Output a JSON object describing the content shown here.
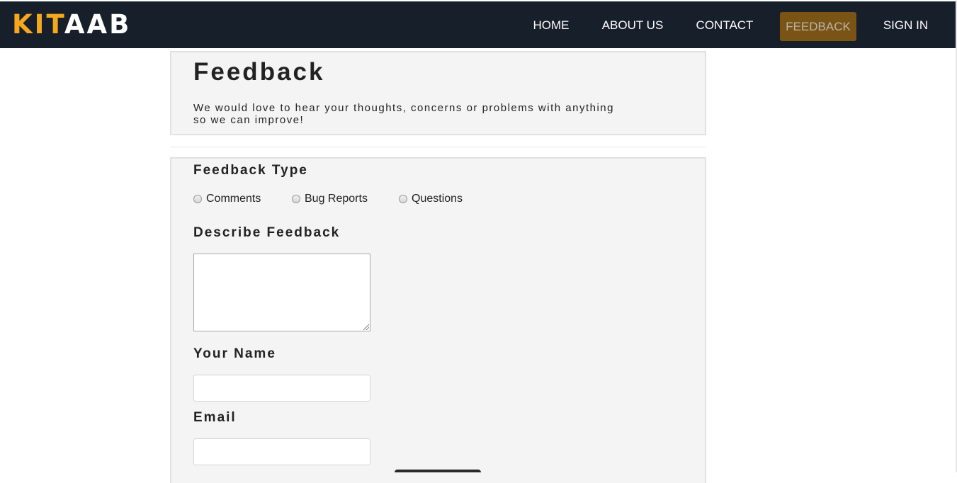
{
  "nav": {
    "logo_accent": "KIT",
    "logo_rest": "AAB",
    "items": [
      {
        "label": "HOME"
      },
      {
        "label": "ABOUT US"
      },
      {
        "label": "CONTACT"
      },
      {
        "label": "FEEDBACK",
        "active": true
      },
      {
        "label": "SIGN IN"
      }
    ]
  },
  "header": {
    "title": "Feedback",
    "subtitle": "We would love to hear your thoughts, concerns or problems with anything so we can improve!"
  },
  "form": {
    "type_label": "Feedback Type",
    "type_options": [
      "Comments",
      "Bug Reports",
      "Questions"
    ],
    "describe_label": "Describe Feedback",
    "describe_value": "",
    "name_label": "Your Name",
    "name_value": "",
    "email_label": "Email",
    "email_value": ""
  },
  "colors": {
    "navbar_bg": "#171f2b",
    "logo_accent": "#f5a81e",
    "active_nav_bg": "#7a5415",
    "card_bg": "#f3f4f3"
  }
}
